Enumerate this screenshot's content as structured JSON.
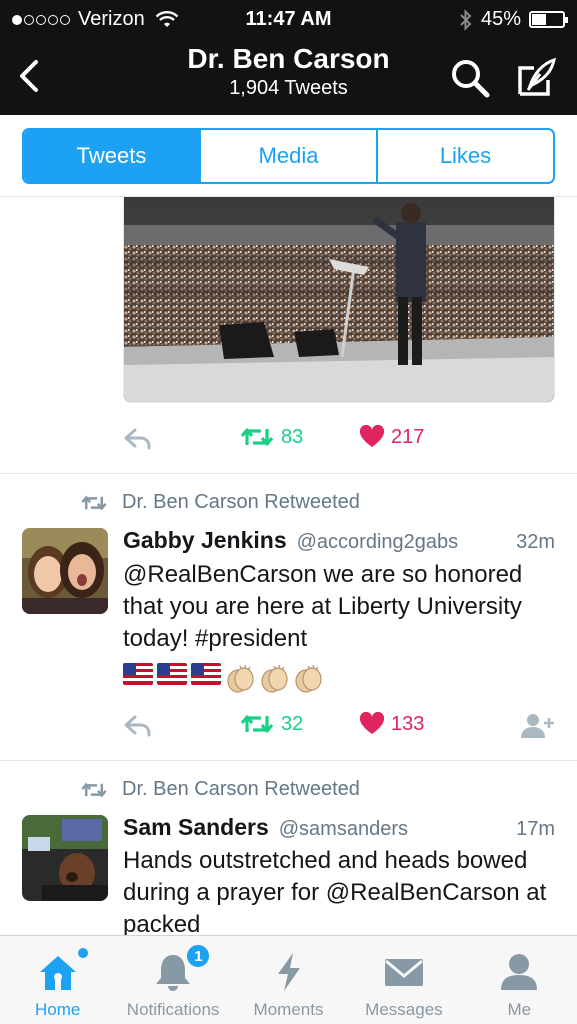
{
  "status": {
    "carrier": "Verizon",
    "time": "11:47 AM",
    "battery": "45%",
    "battery_level": 0.45
  },
  "header": {
    "name": "Dr. Ben Carson",
    "tweet_count": "1,904 Tweets"
  },
  "segments": [
    {
      "label": "Tweets",
      "active": true
    },
    {
      "label": "Media",
      "active": false
    },
    {
      "label": "Likes",
      "active": false
    }
  ],
  "tweets": [
    {
      "retweets": "83",
      "likes": "217"
    },
    {
      "retweeted_by": "Dr. Ben Carson Retweeted",
      "name": "Gabby Jenkins",
      "handle": "@according2gabs",
      "time": "32m",
      "text": "@RealBenCarson we are so honored that you are here at Liberty University today! #president",
      "emojis": [
        "us-flag",
        "us-flag",
        "us-flag",
        "clapping-hands",
        "clapping-hands",
        "clapping-hands"
      ],
      "retweets": "32",
      "likes": "133"
    },
    {
      "retweeted_by": "Dr. Ben Carson Retweeted",
      "name": "Sam Sanders",
      "handle": "@samsanders",
      "time": "17m",
      "text": "Hands outstretched and heads bowed during a prayer for @RealBenCarson at packed"
    }
  ],
  "tabbar": {
    "items": [
      {
        "label": "Home",
        "icon": "home-icon",
        "active": true
      },
      {
        "label": "Notifications",
        "icon": "bell-icon",
        "badge": "1"
      },
      {
        "label": "Moments",
        "icon": "lightning-icon"
      },
      {
        "label": "Messages",
        "icon": "envelope-icon"
      },
      {
        "label": "Me",
        "icon": "person-icon"
      }
    ]
  },
  "colors": {
    "accent": "#1da1f2",
    "retweet": "#19cf86",
    "like": "#e0245e",
    "muted": "#657786",
    "nav_bg": "#121212"
  }
}
